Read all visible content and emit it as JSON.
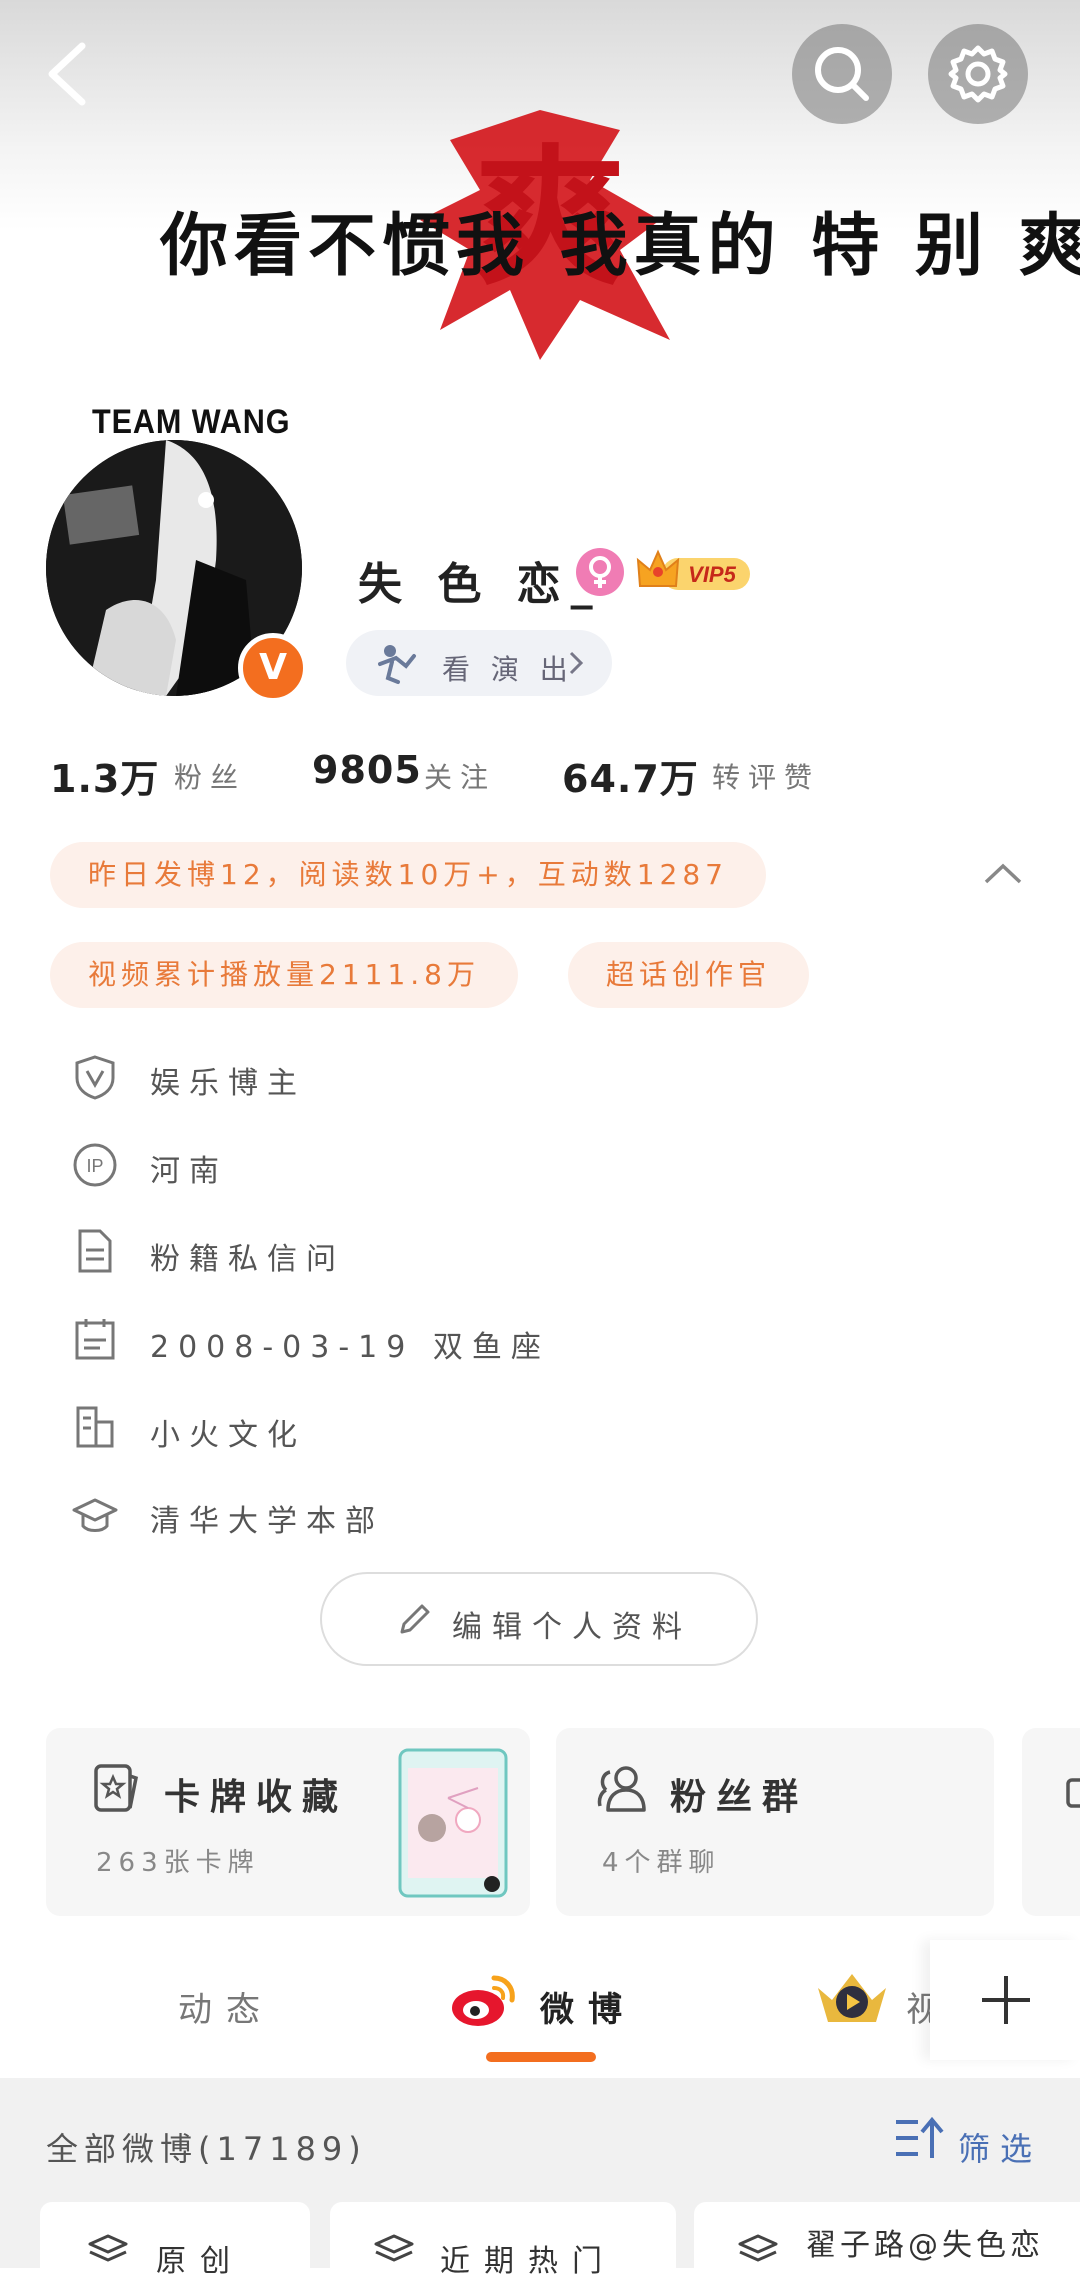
{
  "cover": {
    "slogan": "你看不惯我 我真的 特 别 爽",
    "brush_char": "爽"
  },
  "profile": {
    "avatar_tag": "TEAM WANG",
    "verify_mark": "V",
    "username": "失 色 恋_",
    "vip_label": "VIP5",
    "show_link": "看 演 出",
    "stats": [
      {
        "num": "1.3万",
        "label": "粉丝"
      },
      {
        "num": "9805",
        "label": "关注"
      },
      {
        "num": "64.7万",
        "label": "转评赞"
      }
    ]
  },
  "highlights": {
    "daily": "昨日发博12，阅读数10万+，互动数1287",
    "video": "视频累计播放量2111.8万",
    "role": "超话创作官"
  },
  "info": [
    {
      "icon": "shield-v-icon",
      "text": "娱乐博主"
    },
    {
      "icon": "ip-icon",
      "text": "河南"
    },
    {
      "icon": "document-icon",
      "text": "粉籍私信问"
    },
    {
      "icon": "calendar-icon",
      "text": "2008-03-19 双鱼座"
    },
    {
      "icon": "building-icon",
      "text": "小火文化"
    },
    {
      "icon": "graduation-cap-icon",
      "text": "清华大学本部"
    }
  ],
  "edit_profile": "编辑个人资料",
  "cards": {
    "collection": {
      "title": "卡牌收藏",
      "sub": "263张卡牌"
    },
    "fan_group": {
      "title": "粉丝群",
      "sub": "4个群聊"
    }
  },
  "tabs": [
    "动态",
    "微博",
    "视"
  ],
  "feed": {
    "count": "全部微博(17189)",
    "filter": "筛选",
    "chips": [
      "原创",
      "近期热门"
    ],
    "third_chip_text": "翟子路",
    "watermark": "@失色恋"
  },
  "colors": {
    "accent": "#f36e1f",
    "tag_bg": "#fdf0ea",
    "tag_text": "#e87a3a",
    "link_blue": "#4a70b5"
  }
}
